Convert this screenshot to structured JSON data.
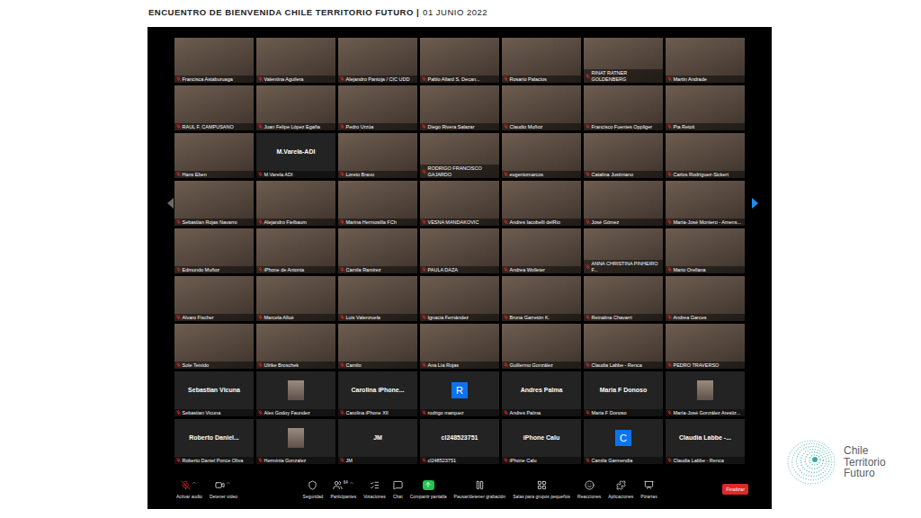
{
  "slide": {
    "title": "ENCUENTRO DE BIENVENIDA CHILE TERRITORIO FUTURO |",
    "date": "01 JUNIO 2022"
  },
  "participants": [
    {
      "kind": "video",
      "name": "Francisca Astaburuaga",
      "muted": true
    },
    {
      "kind": "video",
      "name": "Valentina Aguilera",
      "muted": true
    },
    {
      "kind": "video",
      "name": "Alejandro Pantoja / CIC UDD",
      "muted": true
    },
    {
      "kind": "video",
      "name": "Pablo Allard S. Decan...",
      "muted": true
    },
    {
      "kind": "video",
      "name": "Rosario Palacios",
      "muted": true
    },
    {
      "kind": "video",
      "name": "RINAT RATNER GOLDENBERG",
      "muted": true
    },
    {
      "kind": "video",
      "name": "Martin Andrade",
      "muted": true
    },
    {
      "kind": "video",
      "name": "RAUL F. CAMPUSANO",
      "muted": true
    },
    {
      "kind": "video",
      "name": "Juan Felipe López Egaña",
      "muted": true
    },
    {
      "kind": "video",
      "name": "Pedro Urzúa",
      "muted": true
    },
    {
      "kind": "video",
      "name": "Diego Rivera Salazar",
      "muted": true
    },
    {
      "kind": "video",
      "name": "Claudio Muñoz",
      "muted": true
    },
    {
      "kind": "video",
      "name": "Francisco Fuentes Oppliger",
      "muted": true
    },
    {
      "kind": "video",
      "name": "Pia Retoit",
      "muted": true
    },
    {
      "kind": "video",
      "name": "Hans Eben",
      "muted": true
    },
    {
      "kind": "name",
      "label": "M.Varela-ADI",
      "name": "M.Varela ADI",
      "muted": true
    },
    {
      "kind": "video",
      "name": "Loreto Bravo",
      "muted": true
    },
    {
      "kind": "video",
      "name": "RODRIGO FRANCISCO GAJARDO",
      "muted": true
    },
    {
      "kind": "video",
      "name": "eugeniomarcos",
      "muted": true
    },
    {
      "kind": "video",
      "name": "Catalina Justiniano",
      "muted": true
    },
    {
      "kind": "video",
      "name": "Carlos Rodríguez-Sickert",
      "muted": true
    },
    {
      "kind": "video",
      "name": "Sebastian Rojas Navarro",
      "muted": true
    },
    {
      "kind": "video",
      "name": "Alejandro Fielbaum",
      "muted": true
    },
    {
      "kind": "video",
      "name": "Marina Hermosilla FCh",
      "muted": true
    },
    {
      "kind": "video",
      "name": "VESNA MANDAKOVIC",
      "muted": true
    },
    {
      "kind": "video",
      "name": "Andres Iacobelli delRio",
      "muted": true
    },
    {
      "kind": "video",
      "name": "José Gómez",
      "muted": true
    },
    {
      "kind": "video",
      "name": "María-José Montero - Amens...",
      "muted": true
    },
    {
      "kind": "video",
      "name": "Edmundo Muñoz",
      "muted": true
    },
    {
      "kind": "video",
      "name": "iPhone de Antonia",
      "muted": true
    },
    {
      "kind": "video",
      "name": "Camila Ramirez",
      "muted": true
    },
    {
      "kind": "video",
      "name": "PAULA DAZA",
      "muted": true
    },
    {
      "kind": "video",
      "name": "Andrea Wolleter",
      "muted": true
    },
    {
      "kind": "video",
      "name": "ANNA CHRISTINA PINHEIRO F...",
      "muted": true
    },
    {
      "kind": "video",
      "name": "Mario Orellana",
      "muted": true
    },
    {
      "kind": "video",
      "name": "Alvaro Fischer",
      "muted": true
    },
    {
      "kind": "video",
      "name": "Marcela Allué",
      "muted": true
    },
    {
      "kind": "video",
      "name": "Luis Valenzuela",
      "muted": true
    },
    {
      "kind": "video",
      "name": "Ignacia Fernández",
      "muted": true
    },
    {
      "kind": "video",
      "name": "Bruna Garretón K.",
      "muted": true
    },
    {
      "kind": "video",
      "name": "Reinalina Chavarri",
      "muted": true
    },
    {
      "kind": "video",
      "name": "Andrea Garces",
      "muted": true
    },
    {
      "kind": "video",
      "name": "Sole Teixido",
      "muted": true
    },
    {
      "kind": "video",
      "name": "Ulrike Broschek",
      "muted": true
    },
    {
      "kind": "video",
      "name": "Camilo",
      "muted": true
    },
    {
      "kind": "video",
      "name": "Ana Lía Rojas",
      "muted": true
    },
    {
      "kind": "video",
      "name": "Guillermo González",
      "muted": true
    },
    {
      "kind": "video",
      "name": "Claudia Labbe - Renca",
      "muted": true
    },
    {
      "kind": "video",
      "name": "PEDRO TRAVERSO",
      "muted": true
    },
    {
      "kind": "name",
      "label": "Sebastian Vicuna",
      "name": "Sebastian Vicuna",
      "muted": true
    },
    {
      "kind": "photo",
      "name": "Alex Godoy Faundez",
      "muted": true
    },
    {
      "kind": "name",
      "label": "Carolina iPhone...",
      "name": "Carolina iPhone XII",
      "muted": true
    },
    {
      "kind": "avatar",
      "label": "R",
      "name": "rodrigo marquez",
      "muted": true
    },
    {
      "kind": "name",
      "label": "Andres Palma",
      "name": "Andres Palma",
      "muted": true
    },
    {
      "kind": "name",
      "label": "Maria F Donoso",
      "name": "Maria F Donoso",
      "muted": true
    },
    {
      "kind": "photo",
      "name": "María-José González Arestiz...",
      "muted": true
    },
    {
      "kind": "name",
      "label": "Roberto Daniel...",
      "name": "Roberto Daniel Ponce Oliva",
      "muted": true
    },
    {
      "kind": "photo",
      "name": "Herminia Gonzalez",
      "muted": true
    },
    {
      "kind": "name",
      "label": "JM",
      "name": "JM",
      "muted": true
    },
    {
      "kind": "name",
      "label": "cl248523751",
      "name": "cl248523751",
      "muted": true
    },
    {
      "kind": "name",
      "label": "iPhone Calu",
      "name": "iPhone Calu",
      "muted": true
    },
    {
      "kind": "avatar",
      "label": "C",
      "name": "Camila Garmendia",
      "muted": true
    },
    {
      "kind": "name",
      "label": "Claudia Labbe -...",
      "name": "Claudia Labbe - Renca",
      "muted": true
    }
  ],
  "toolbar": {
    "left": [
      {
        "kind": "audio",
        "label": "Activar audio",
        "muted": true
      },
      {
        "kind": "video",
        "label": "Detener video",
        "muted": false
      }
    ],
    "center": [
      {
        "kind": "security",
        "label": "Seguridad"
      },
      {
        "kind": "participants",
        "label": "Participantes",
        "count": "64"
      },
      {
        "kind": "polls",
        "label": "Votaciones"
      },
      {
        "kind": "chat",
        "label": "Chat"
      },
      {
        "kind": "share",
        "label": "Compartir pantalla"
      },
      {
        "kind": "record",
        "label": "Pausar/detener grabación"
      },
      {
        "kind": "rooms",
        "label": "Salas para grupos pequeños"
      },
      {
        "kind": "reactions",
        "label": "Reacciones"
      },
      {
        "kind": "apps",
        "label": "Aplicaciones"
      },
      {
        "kind": "whiteboards",
        "label": "Pizarras"
      }
    ],
    "end_button": "Finalizar"
  },
  "logo": {
    "lines": [
      "Chile",
      "Territorio",
      "Futuro"
    ]
  }
}
